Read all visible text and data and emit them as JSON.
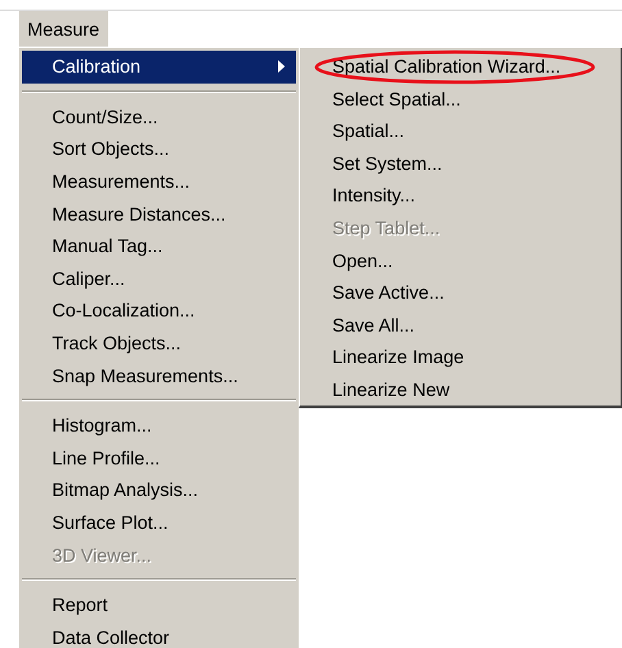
{
  "menu_bar": [
    {
      "label": "Measure",
      "selected": true
    }
  ],
  "menu": [
    {
      "kind": "item",
      "label": "Calibration",
      "selected": true,
      "disabled": false,
      "has_submenu": true
    },
    {
      "kind": "separator"
    },
    {
      "kind": "item",
      "label": "Count/Size...",
      "selected": false,
      "disabled": false,
      "has_submenu": false
    },
    {
      "kind": "item",
      "label": "Sort Objects...",
      "selected": false,
      "disabled": false,
      "has_submenu": false
    },
    {
      "kind": "item",
      "label": "Measurements...",
      "selected": false,
      "disabled": false,
      "has_submenu": false
    },
    {
      "kind": "item",
      "label": "Measure Distances...",
      "selected": false,
      "disabled": false,
      "has_submenu": false
    },
    {
      "kind": "item",
      "label": "Manual Tag...",
      "selected": false,
      "disabled": false,
      "has_submenu": false
    },
    {
      "kind": "item",
      "label": "Caliper...",
      "selected": false,
      "disabled": false,
      "has_submenu": false
    },
    {
      "kind": "item",
      "label": "Co-Localization...",
      "selected": false,
      "disabled": false,
      "has_submenu": false
    },
    {
      "kind": "item",
      "label": "Track Objects...",
      "selected": false,
      "disabled": false,
      "has_submenu": false
    },
    {
      "kind": "item",
      "label": "Snap Measurements...",
      "selected": false,
      "disabled": false,
      "has_submenu": false
    },
    {
      "kind": "separator"
    },
    {
      "kind": "item",
      "label": "Histogram...",
      "selected": false,
      "disabled": false,
      "has_submenu": false
    },
    {
      "kind": "item",
      "label": "Line Profile...",
      "selected": false,
      "disabled": false,
      "has_submenu": false
    },
    {
      "kind": "item",
      "label": "Bitmap Analysis...",
      "selected": false,
      "disabled": false,
      "has_submenu": false
    },
    {
      "kind": "item",
      "label": "Surface Plot...",
      "selected": false,
      "disabled": false,
      "has_submenu": false
    },
    {
      "kind": "item",
      "label": "3D Viewer...",
      "selected": false,
      "disabled": true,
      "has_submenu": false
    },
    {
      "kind": "separator"
    },
    {
      "kind": "item",
      "label": "Report",
      "selected": false,
      "disabled": false,
      "has_submenu": false
    },
    {
      "kind": "item",
      "label": "Data Collector",
      "selected": false,
      "disabled": false,
      "has_submenu": false
    }
  ],
  "submenu": [
    {
      "label": "Spatial Calibration Wizard...",
      "disabled": false,
      "circled": true
    },
    {
      "label": "Select Spatial...",
      "disabled": false,
      "circled": false
    },
    {
      "label": "Spatial...",
      "disabled": false,
      "circled": false
    },
    {
      "label": "Set System...",
      "disabled": false,
      "circled": false
    },
    {
      "label": "Intensity...",
      "disabled": false,
      "circled": false
    },
    {
      "label": "Step Tablet...",
      "disabled": true,
      "circled": false
    },
    {
      "label": "Open...",
      "disabled": false,
      "circled": false
    },
    {
      "label": "Save Active...",
      "disabled": false,
      "circled": false
    },
    {
      "label": "Save All...",
      "disabled": false,
      "circled": false
    },
    {
      "label": "Linearize Image",
      "disabled": false,
      "circled": false
    },
    {
      "label": "Linearize New",
      "disabled": false,
      "circled": false
    }
  ]
}
